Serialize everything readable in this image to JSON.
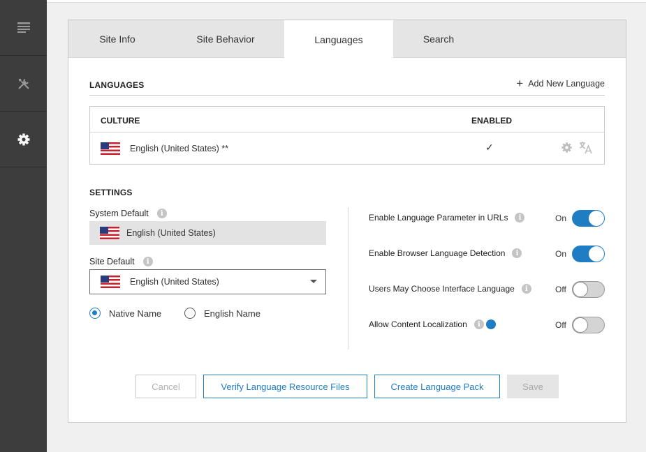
{
  "rail": {
    "items": [
      {
        "icon": "document-list-icon"
      },
      {
        "icon": "tools-icon"
      },
      {
        "icon": "gear-icon"
      }
    ]
  },
  "tabs": [
    {
      "label": "Site Info",
      "active": false
    },
    {
      "label": "Site Behavior",
      "active": false
    },
    {
      "label": "Languages",
      "active": true
    },
    {
      "label": "Search",
      "active": false
    }
  ],
  "languages": {
    "title": "LANGUAGES",
    "add_label": "Add New Language",
    "columns": {
      "culture": "CULTURE",
      "enabled": "ENABLED"
    },
    "rows": [
      {
        "culture": "English (United States) **",
        "enabled": true,
        "enabled_mark": "✓",
        "flag": "us-flag"
      }
    ]
  },
  "settings": {
    "title": "SETTINGS",
    "system_default": {
      "label": "System Default",
      "value": "English (United States)"
    },
    "site_default": {
      "label": "Site Default",
      "value": "English (United States)"
    },
    "name_display": {
      "options": [
        {
          "label": "Native Name",
          "selected": true
        },
        {
          "label": "English Name",
          "selected": false
        }
      ]
    },
    "options": [
      {
        "label": "Enable Language Parameter in URLs",
        "state": "On",
        "on": true
      },
      {
        "label": "Enable Browser Language Detection",
        "state": "On",
        "on": true
      },
      {
        "label": "Users May Choose Interface Language",
        "state": "Off",
        "on": false
      },
      {
        "label": "Allow Content Localization",
        "state": "Off",
        "on": false
      }
    ]
  },
  "buttons": {
    "cancel": "Cancel",
    "verify": "Verify Language Resource Files",
    "create_pack": "Create Language Pack",
    "save": "Save"
  },
  "colors": {
    "accent": "#1f7dc4",
    "rail": "#3d3d3d",
    "tab_bar": "#e5e5e5"
  }
}
